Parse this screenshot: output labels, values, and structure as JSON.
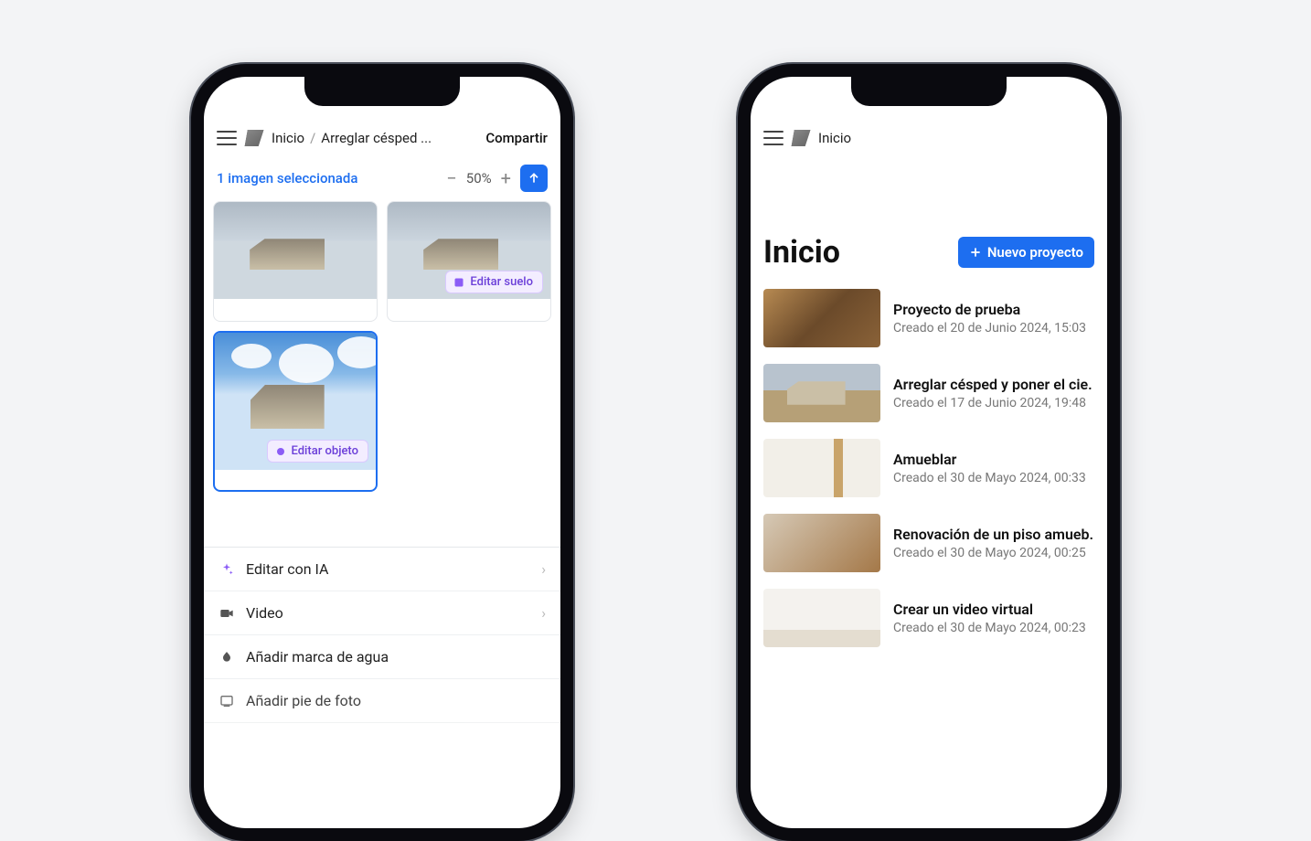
{
  "phone1": {
    "header": {
      "breadcrumb_home": "Inicio",
      "breadcrumb_page": "Arreglar césped ...",
      "share": "Compartir"
    },
    "selection_text": "1 imagen seleccionada",
    "zoom_level": "50%",
    "thumbnails": [
      {
        "badge": null
      },
      {
        "badge": "Editar suelo"
      },
      {
        "badge": "Editar objeto",
        "selected": true
      }
    ],
    "menu": {
      "edit_ai": "Editar con IA",
      "video": "Video",
      "watermark": "Añadir marca de agua",
      "caption": "Añadir pie de foto"
    }
  },
  "phone2": {
    "header": {
      "home": "Inicio"
    },
    "page_title": "Inicio",
    "new_project_label": "Nuevo proyecto",
    "projects": [
      {
        "name": "Proyecto de prueba",
        "meta": "Creado el 20 de Junio 2024, 15:03"
      },
      {
        "name": "Arreglar césped y poner el cie.",
        "meta": "Creado el 17 de Junio 2024, 19:48"
      },
      {
        "name": "Amueblar",
        "meta": "Creado el 30 de Mayo 2024, 00:33"
      },
      {
        "name": "Renovación de un piso amueb.",
        "meta": "Creado el 30 de Mayo 2024, 00:25"
      },
      {
        "name": "Crear un video virtual",
        "meta": "Creado el 30 de Mayo 2024, 00:23"
      }
    ]
  },
  "colors": {
    "accent": "#1d6ef0",
    "badge_bg": "#f3edff",
    "badge_fg": "#6b3fd9"
  }
}
